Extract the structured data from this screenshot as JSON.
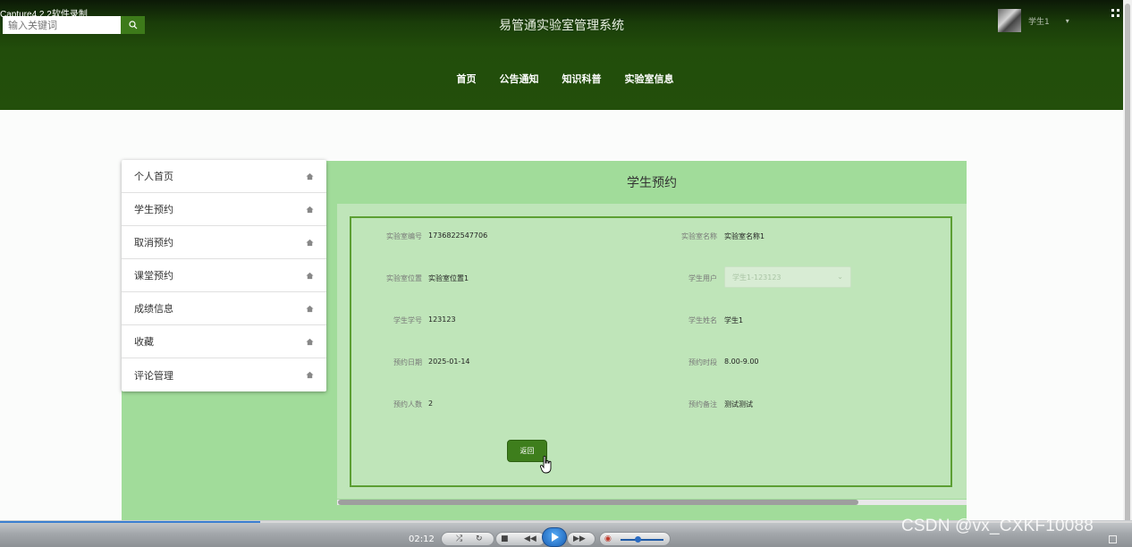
{
  "recorder": {
    "label": "Capture4.2.2软件录制"
  },
  "header": {
    "search_placeholder": "输入关键词",
    "title": "易管通实验室管理系统",
    "user_name": "学生1",
    "user_caret": "▾",
    "nav": [
      "首页",
      "公告通知",
      "知识科普",
      "实验室信息"
    ]
  },
  "sidebar": {
    "items": [
      "个人首页",
      "学生预约",
      "取消预约",
      "课堂预约",
      "成绩信息",
      "收藏",
      "评论管理"
    ]
  },
  "content": {
    "title": "学生预约",
    "fields": {
      "lab_no_label": "实验室编号",
      "lab_no_value": "1736822547706",
      "lab_name_label": "实验室名称",
      "lab_name_value": "实验室名称1",
      "lab_loc_label": "实验室位置",
      "lab_loc_value": "实验室位置1",
      "student_user_label": "学生用户",
      "student_user_value": "学生1-123123",
      "student_no_label": "学生学号",
      "student_no_value": "123123",
      "student_name_label": "学生姓名",
      "student_name_value": "学生1",
      "date_label": "预约日期",
      "date_value": "2025-01-14",
      "period_label": "预约时段",
      "period_value": "8.00-9.00",
      "count_label": "预约人数",
      "count_value": "2",
      "note_label": "预约备注",
      "note_value": "测试测试"
    },
    "back_label": "返回"
  },
  "player": {
    "time": "02:12",
    "progress_fraction": 0.23,
    "volume_fraction": 0.4,
    "watermark": "CSDN @vx_CXKF10088"
  },
  "colors": {
    "header_dark": "#1a3d09",
    "panel_green": "#a1dc9a",
    "form_green": "#bfe5b9",
    "button_green": "#3e7e1c"
  }
}
